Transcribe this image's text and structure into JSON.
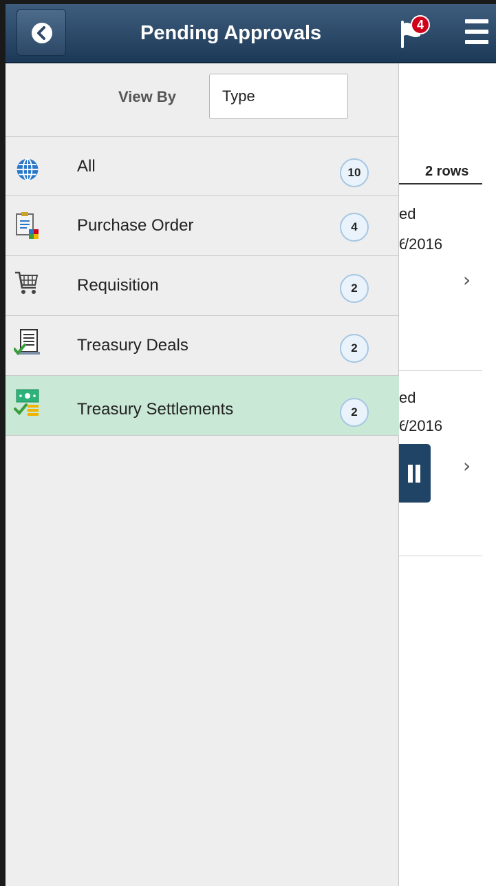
{
  "header": {
    "title": "Pending Approvals",
    "notifications_count": "4",
    "back_icon": "chevron-left-icon",
    "flag_icon": "flag-icon",
    "menu_icon": "hamburger-icon"
  },
  "panel": {
    "view_by_label": "View By",
    "view_by_value": "Type",
    "items": [
      {
        "label": "All",
        "count": "10",
        "icon": "globe-icon",
        "selected": false
      },
      {
        "label": "Purchase Order",
        "count": "4",
        "icon": "purchase-order-icon",
        "selected": false
      },
      {
        "label": "Requisition",
        "count": "2",
        "icon": "cart-icon",
        "selected": false
      },
      {
        "label": "Treasury Deals",
        "count": "2",
        "icon": "document-check-icon",
        "selected": false
      },
      {
        "label": "Treasury Settlements",
        "count": "2",
        "icon": "money-check-icon",
        "selected": true
      }
    ]
  },
  "background": {
    "rows_label": "2 rows",
    "cards": [
      {
        "status_fragment": "ed",
        "date_fragment": "/2016"
      },
      {
        "status_fragment": "ed",
        "date_fragment": "/2016"
      }
    ]
  },
  "colors": {
    "header": "#1d3958",
    "selected_row": "#c9e8d6",
    "badge": "#d0021b",
    "panel_bg": "#eeeeee"
  }
}
